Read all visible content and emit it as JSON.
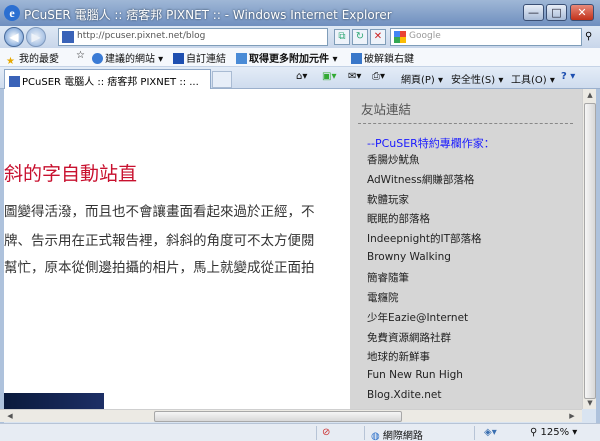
{
  "window": {
    "title": "PCuSER 電腦人 :: 痞客邦 PIXNET :: - Windows Internet Explorer",
    "minimize": "—",
    "maximize": "□",
    "close": "✕"
  },
  "address": {
    "url": "http://pcuser.pixnet.net/blog",
    "back": "◀",
    "forward": "▶"
  },
  "search": {
    "placeholder": "Google"
  },
  "favorites_bar": {
    "favorites": "我的最愛",
    "suggested": "建議的網站 ▾",
    "custom": "自訂連結",
    "more_addons": "取得更多附加元件 ▾",
    "broken_link": "破解鎖右鍵"
  },
  "tab": {
    "label": "PCuSER 電腦人 :: 痞客邦 PIXNET :: ..."
  },
  "toolbar": {
    "page": "網頁(P) ▾",
    "safety": "安全性(S) ▾",
    "tools": "工具(O) ▾",
    "help": "? ▾"
  },
  "content": {
    "heading": "斜的字自動站直",
    "lines": [
      "圖變得活潑，而且也不會讓畫面看起來過於正經，不",
      "牌、告示用在正式報告裡，斜斜的角度可不太方便閱",
      "幫忙，原本從側邊拍攝的相片，馬上就變成從正面拍"
    ]
  },
  "sidebar": {
    "title": "友站連結",
    "subtitle": "--PCuSER特約專欄作家：",
    "links": [
      "香腸炒魷魚",
      "AdWitness網賺部落格",
      "軟體玩家",
      "眠眠的部落格",
      "Indeepnight的IT部落格",
      "Browny Walking",
      "簡睿隨筆",
      "電癮院",
      "少年Eazie@Internet",
      "免費資源網路社群",
      "地球的新鮮事",
      "Fun New Run High",
      "Blog.Xdite.net"
    ]
  },
  "status": {
    "zone": "網際網路",
    "zoom": "125%"
  }
}
